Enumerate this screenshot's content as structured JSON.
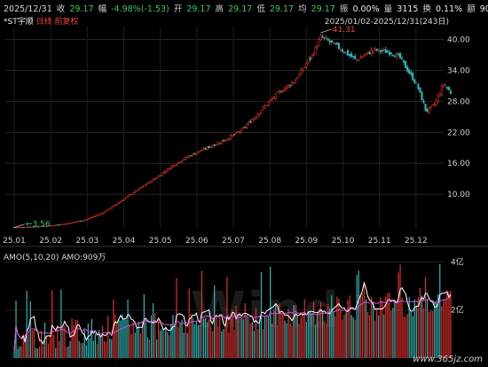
{
  "header": {
    "date": "2025/12/31",
    "close_label": "收",
    "close_value": "29.17",
    "change_label": "幅",
    "change_value": "-4.98%(-1.53)",
    "open_label": "开",
    "open_value": "29.17",
    "high_label": "高",
    "high_value": "29.17",
    "low_label": "低",
    "low_value": "29.17",
    "avg_label": "均",
    "avg_value": "29.17",
    "amp_label": "振",
    "amp_value": "0.00%",
    "vol_label": "量",
    "vol_value": "3115",
    "turnover_label": "换",
    "turnover_value": "0.11%",
    "amount_label": "额",
    "amount_value": "909万"
  },
  "stock": {
    "name": "*ST宇顺",
    "period": "日线",
    "adjust": "前复权"
  },
  "range_text": "2025/01/02-2025/12/31(243日)",
  "indicator_label": "AMO(5,10,20)  AMO:909万",
  "watermark": "www.365jz.com",
  "colors": {
    "up": "#e0302c",
    "down": "#2fb6b6",
    "ma": "#d050d0",
    "amo": "#ffffff"
  },
  "chart_data": [
    {
      "type": "candlestick",
      "title": "",
      "x_ticks": [
        "25.01",
        "25.02",
        "25.03",
        "25.04",
        "25.05",
        "25.06",
        "25.07",
        "25.08",
        "25.09",
        "25.10",
        "25.11",
        "25.12"
      ],
      "y_ticks": [
        10.0,
        16.0,
        22.0,
        28.0,
        34.0,
        40.0
      ],
      "y_tick_labels": [
        "10.00",
        "16.00",
        "22.00",
        "28.00",
        "34.00",
        "40.00"
      ],
      "ylim": [
        3.5,
        42.5
      ],
      "annotations": [
        {
          "label": "41.31",
          "x": 2025.7,
          "y": 41.31
        },
        {
          "label": "3.56",
          "x": 2025.0,
          "y": 3.56
        }
      ],
      "close_path_x": [
        2025.0,
        2025.04,
        2025.08,
        2025.12,
        2025.16,
        2025.2,
        2025.24,
        2025.28,
        2025.32,
        2025.36,
        2025.4,
        2025.44,
        2025.48,
        2025.52,
        2025.56,
        2025.6,
        2025.64,
        2025.68,
        2025.7,
        2025.74,
        2025.78,
        2025.82,
        2025.86,
        2025.88,
        2025.92,
        2025.94,
        2025.96,
        2025.98,
        2026.0
      ],
      "close_path_y": [
        3.6,
        3.7,
        3.9,
        4.3,
        5.0,
        6.3,
        8.5,
        10.8,
        13.0,
        15.5,
        17.5,
        19.0,
        20.5,
        22.5,
        26.0,
        29.5,
        32.0,
        37.0,
        40.5,
        38.5,
        36.0,
        38.0,
        37.5,
        36.5,
        31.0,
        26.0,
        27.5,
        31.5,
        29.17
      ]
    },
    {
      "type": "bar",
      "title": "",
      "series": [
        {
          "name": "AMO",
          "kind": "bar"
        },
        {
          "name": "MA5",
          "kind": "line"
        },
        {
          "name": "MA20",
          "kind": "line"
        }
      ],
      "y_ticks": [
        2,
        4
      ],
      "y_tick_labels": [
        "2亿",
        "4亿"
      ],
      "ylim": [
        0,
        4.2
      ]
    }
  ]
}
